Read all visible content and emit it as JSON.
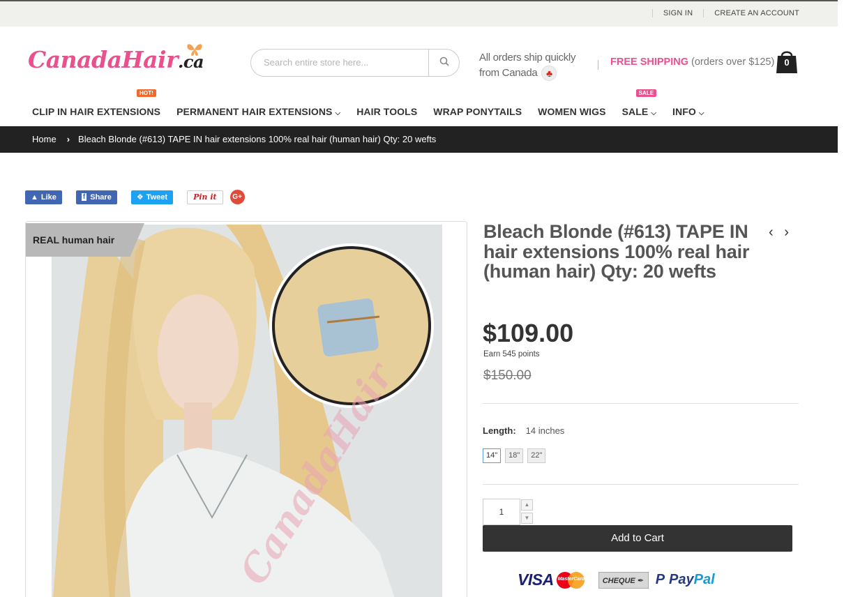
{
  "topbar": {
    "sign_in": "SIGN IN",
    "create_account": "CREATE AN ACCOUNT"
  },
  "logo": {
    "main": "CanadaHair",
    "suffix": ".ca",
    "icon": "butterfly-icon"
  },
  "search": {
    "placeholder": "Search entire store here..."
  },
  "shipping": {
    "line1": "All orders ship quickly",
    "line2": "from Canada",
    "free_label": "FREE SHIPPING",
    "free_note": "(orders over $125)"
  },
  "cart": {
    "count": "0"
  },
  "nav": {
    "items": [
      {
        "label": "CLIP IN HAIR EXTENSIONS",
        "badge": "HOT!"
      },
      {
        "label": "PERMANENT HAIR EXTENSIONS"
      },
      {
        "label": "HAIR TOOLS"
      },
      {
        "label": "WRAP PONYTAILS"
      },
      {
        "label": "WOMEN WIGS"
      },
      {
        "label": "SALE",
        "badge": "SALE"
      },
      {
        "label": "INFO"
      }
    ]
  },
  "breadcrumb": {
    "home": "Home",
    "current": "Bleach Blonde (#613) TAPE IN hair extensions 100% real hair (human hair) Qty: 20 wefts"
  },
  "social": {
    "like": "Like",
    "share": "Share",
    "tweet": "Tweet",
    "pin": "Pin it",
    "gplus": "G+"
  },
  "gallery": {
    "ribbon": "REAL human hair",
    "watermark": "CanadaHair"
  },
  "product": {
    "title": "Bleach Blonde (#613) TAPE IN hair extensions 100% real hair (human hair) Qty: 20 wefts",
    "price": "$109.00",
    "points": "Earn 545 points",
    "old_price": "$150.00",
    "length_label": "Length:",
    "length_value": "14 inches",
    "options": [
      "14\"",
      "18\"",
      "22\""
    ],
    "quantity": "1",
    "add_to_cart": "Add to Cart"
  },
  "payments": {
    "visa": "VISA",
    "mastercard": "MasterCard",
    "cheque": "CHEQUE",
    "paypal_a": "Pay",
    "paypal_b": "Pal"
  },
  "colors": {
    "brand_pink": "#e9508d",
    "dark": "#222222",
    "hot": "#f26a2b"
  }
}
